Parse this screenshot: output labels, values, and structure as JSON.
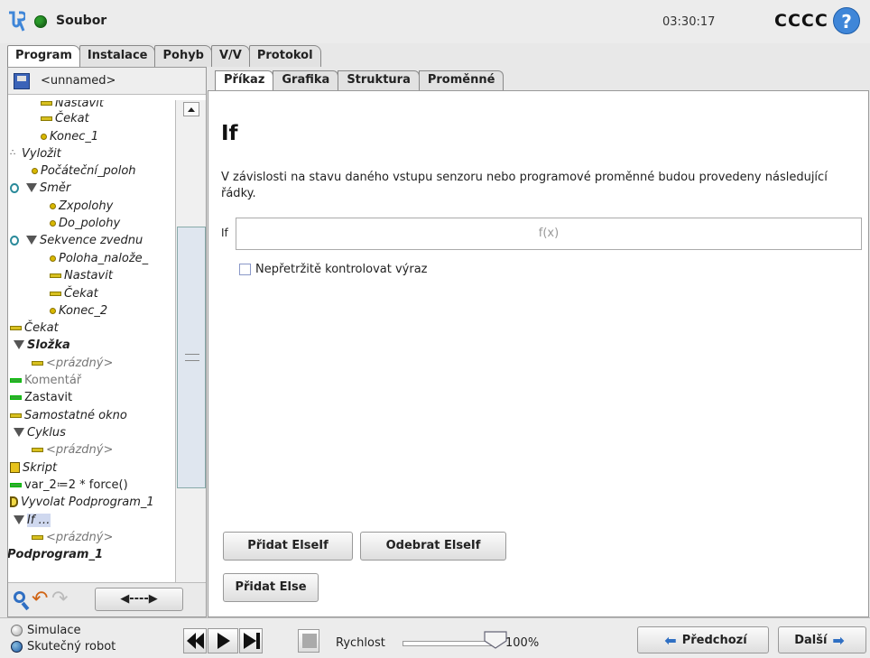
{
  "header": {
    "file_label": "Soubor",
    "clock": "03:30:17",
    "robot_name": "CCCC",
    "help_symbol": "?"
  },
  "main_tabs": [
    "Program",
    "Instalace",
    "Pohyb",
    "V/V",
    "Protokol"
  ],
  "program": {
    "name": "<unnamed>",
    "tree": [
      {
        "label": "Nastavit",
        "icon": "set-icon",
        "style": "italic"
      },
      {
        "label": "Čekat",
        "icon": "wait-icon",
        "style": "italic"
      },
      {
        "label": "Konec_1",
        "icon": "waypoint-icon",
        "style": "italic"
      },
      {
        "label": "Vyložit",
        "icon": "pallet-icon",
        "style": "italic"
      },
      {
        "label": "Počáteční_poloh",
        "icon": "waypoint-icon",
        "style": "italic"
      },
      {
        "label": "Směr",
        "icon": "direction-icon",
        "style": "italic"
      },
      {
        "label": "Zxpolohy",
        "icon": "waypoint-icon",
        "style": "italic"
      },
      {
        "label": "Do_polohy",
        "icon": "waypoint-icon",
        "style": "italic"
      },
      {
        "label": "Sekvence zvednu",
        "icon": "direction-icon",
        "style": "italic"
      },
      {
        "label": "Poloha_nalože_",
        "icon": "waypoint-icon",
        "style": "italic"
      },
      {
        "label": "Nastavit",
        "icon": "set-icon",
        "style": "italic"
      },
      {
        "label": "Čekat",
        "icon": "wait-icon",
        "style": "italic"
      },
      {
        "label": "Konec_2",
        "icon": "waypoint-icon",
        "style": "italic"
      },
      {
        "label": "Čekat",
        "icon": "wait-icon",
        "style": "italic"
      },
      {
        "label": "Složka",
        "icon": "folder-icon",
        "style": "bold-italic"
      },
      {
        "label": "<prázdný>",
        "icon": "empty-icon",
        "style": "muted"
      },
      {
        "label": "Komentář",
        "icon": "comment-icon",
        "style": "muted"
      },
      {
        "label": "Zastavit",
        "icon": "halt-icon",
        "style": "normal"
      },
      {
        "label": "Samostatné okno",
        "icon": "popup-icon",
        "style": "italic"
      },
      {
        "label": "Cyklus",
        "icon": "loop-icon",
        "style": "italic"
      },
      {
        "label": "<prázdný>",
        "icon": "empty-icon",
        "style": "muted"
      },
      {
        "label": "Skript",
        "icon": "script-icon",
        "style": "italic"
      },
      {
        "label": "var_2≔2 * force()",
        "icon": "assign-icon",
        "style": "normal"
      },
      {
        "label": "Vyvolat Podprogram_1",
        "icon": "call-icon",
        "style": "italic"
      },
      {
        "label": "If …",
        "icon": "if-icon",
        "style": "italic-selected"
      },
      {
        "label": "<prázdný>",
        "icon": "empty-icon",
        "style": "muted"
      },
      {
        "label": "Podprogram_1",
        "icon": "subprogram-icon",
        "style": "bold-italic"
      }
    ],
    "move_button": "◀----▶"
  },
  "sub_tabs": [
    "Příkaz",
    "Grafika",
    "Struktura",
    "Proměnné"
  ],
  "command": {
    "title": "If",
    "description": "V závislosti na stavu daného vstupu senzoru nebo programové proměnné budou provedeny následující řádky.",
    "if_label": "If",
    "expression_placeholder": "f(x)",
    "continuous_check_label": "Nepřetržitě kontrolovat výraz",
    "continuous_check_checked": false,
    "add_elseif": "Přidat ElseIf",
    "remove_elseif": "Odebrat ElseIf",
    "add_else": "Přidat Else"
  },
  "footer": {
    "mode_simulation": "Simulace",
    "mode_real_robot": "Skutečný robot",
    "selected_mode": "Skutečný robot",
    "speed_label": "Rychlost",
    "speed_value": "100%",
    "speed_fraction": 1.0,
    "prev_button": "Předchozí",
    "next_button": "Další"
  },
  "colors": {
    "accent_blue": "#2f6fc3",
    "file_status_green": "#2a9a2a",
    "undo_orange": "#d06414"
  }
}
